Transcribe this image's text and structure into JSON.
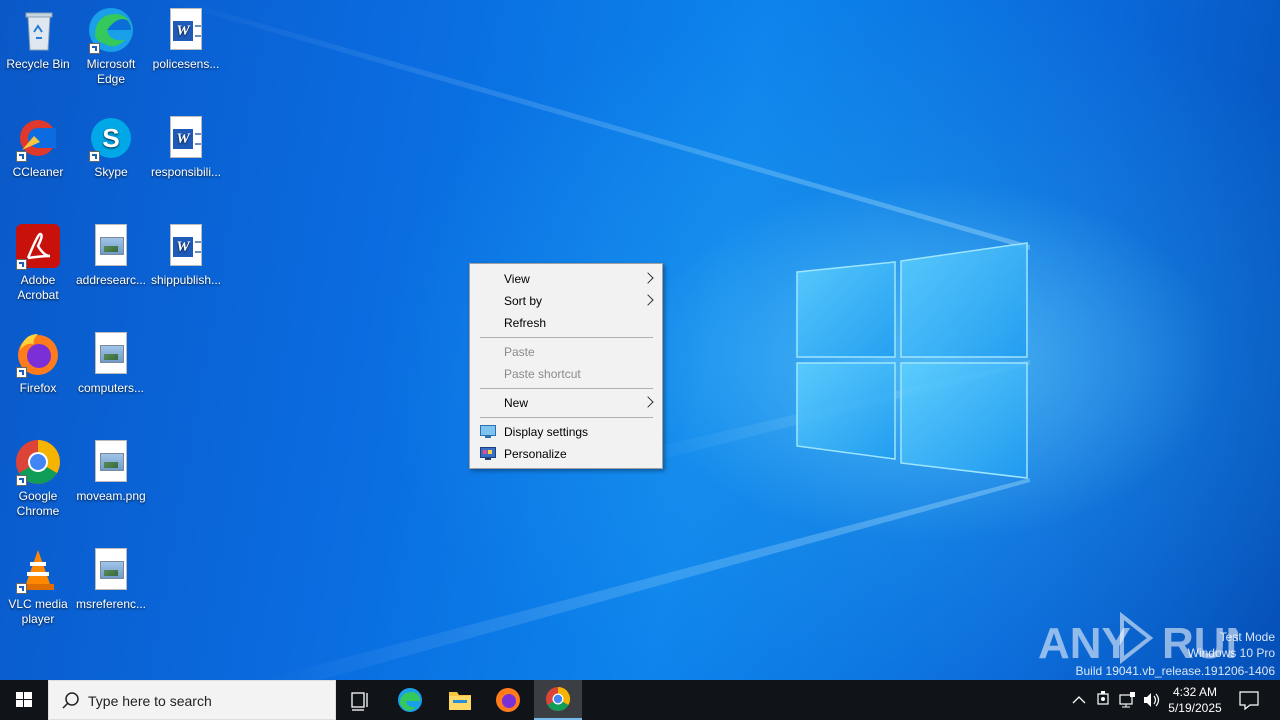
{
  "desktop_icons": {
    "recycle_bin": "Recycle Bin",
    "edge": "Microsoft Edge",
    "policesens": "policesens...",
    "ccleaner": "CCleaner",
    "skype": "Skype",
    "responsibili": "responsibili...",
    "acrobat": "Adobe Acrobat",
    "addresearc": "addresearc...",
    "shippublish": "shippublish...",
    "firefox": "Firefox",
    "computers": "computers...",
    "chrome": "Google Chrome",
    "moveam": "moveam.png",
    "vlc": "VLC media player",
    "msreferenc": "msreferenc..."
  },
  "context_menu": {
    "view": "View",
    "sort_by": "Sort by",
    "refresh": "Refresh",
    "paste": "Paste",
    "paste_shortcut": "Paste shortcut",
    "new": "New",
    "display_settings": "Display settings",
    "personalize": "Personalize"
  },
  "watermark": {
    "brand": "ANY RUN",
    "test_mode": "Test Mode",
    "edition": "Windows 10 Pro",
    "build": "Build 19041.vb_release.191206-1406"
  },
  "taskbar": {
    "search_placeholder": "Type here to search",
    "time": "4:32 AM",
    "date": "5/19/2025",
    "icons": [
      "windows-start-icon",
      "search-icon",
      "task-view-icon",
      "edge-icon",
      "file-explorer-icon",
      "firefox-icon",
      "chrome-icon",
      "chevron-up-icon",
      "network-icon",
      "speaker-icon",
      "notification-icon"
    ]
  },
  "colors": {
    "accent": "#76b9ed",
    "taskbar": "#101418",
    "desktop": "#0a6ce0"
  }
}
